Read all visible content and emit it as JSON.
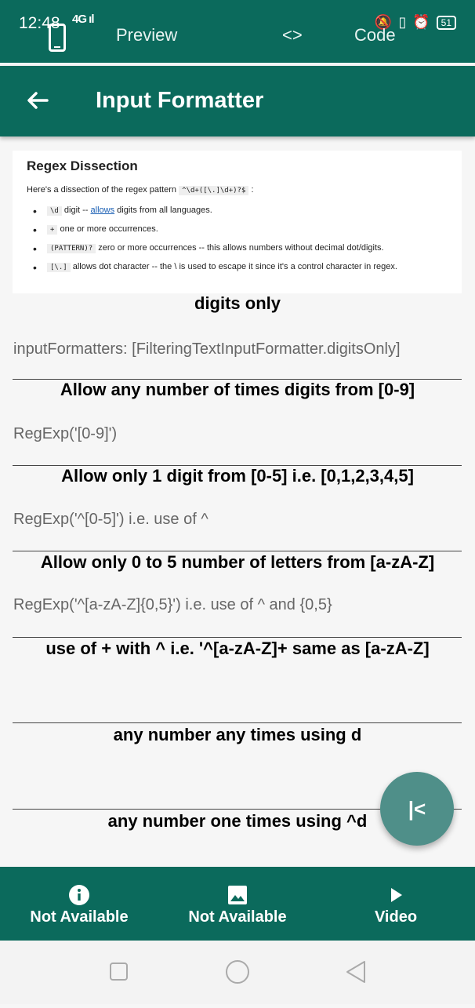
{
  "status_bar": {
    "time": "12:48",
    "network": "4G",
    "battery": "51"
  },
  "top_tabs": {
    "preview_label": "Preview",
    "code_symbol": "<>",
    "code_label": "Code"
  },
  "app_bar": {
    "title": "Input Formatter"
  },
  "doc": {
    "title": "Regex Dissection",
    "intro": "Here's a dissection of the regex pattern",
    "intro_code": "^\\d+([\\.]\\d+)?$",
    "bullets": [
      {
        "code": "\\d",
        "pre": " digit -- ",
        "link": "allows",
        "post": " digits from all languages."
      },
      {
        "code": "+",
        "pre": " one or more occurrences.",
        "link": "",
        "post": ""
      },
      {
        "code": "(PATTERN)?",
        "pre": " zero or more occurrences -- this allows numbers without decimal dot/digits.",
        "link": "",
        "post": ""
      },
      {
        "code": "[\\.]",
        "pre": " allows dot character -- the \\ is used to escape it since it's a control character in regex.",
        "link": "",
        "post": ""
      }
    ]
  },
  "sections": [
    {
      "title": "digits only",
      "body": "inputFormatters: [FilteringTextInputFormatter.digitsOnly]"
    },
    {
      "title": "Allow any number of times digits from [0-9]",
      "body": "RegExp('[0-9]')"
    },
    {
      "title": "Allow only 1 digit from [0-5] i.e. [0,1,2,3,4,5]",
      "body": "RegExp('^[0-5]') i.e. use of ^"
    },
    {
      "title": "Allow only 0 to 5 number of letters from [a-zA-Z]",
      "body": "RegExp('^[a-zA-Z]{0,5}') i.e. use of ^ and {0,5}"
    },
    {
      "title": "use of + with ^ i.e. '^[a-zA-Z]+ same as [a-zA-Z]",
      "body": ""
    },
    {
      "title": "any number any times using d",
      "body": ""
    },
    {
      "title": "any number one times using ^d",
      "body": ""
    }
  ],
  "fab": {
    "label": "|<"
  },
  "bottom_nav": [
    {
      "icon": "info-icon",
      "label": "Not Available"
    },
    {
      "icon": "image-icon",
      "label": "Not Available"
    },
    {
      "icon": "play-icon",
      "label": "Video"
    }
  ],
  "colors": {
    "primary": "#0b6a5c",
    "fab": "#4f8f89",
    "background": "#f6f6f6"
  }
}
